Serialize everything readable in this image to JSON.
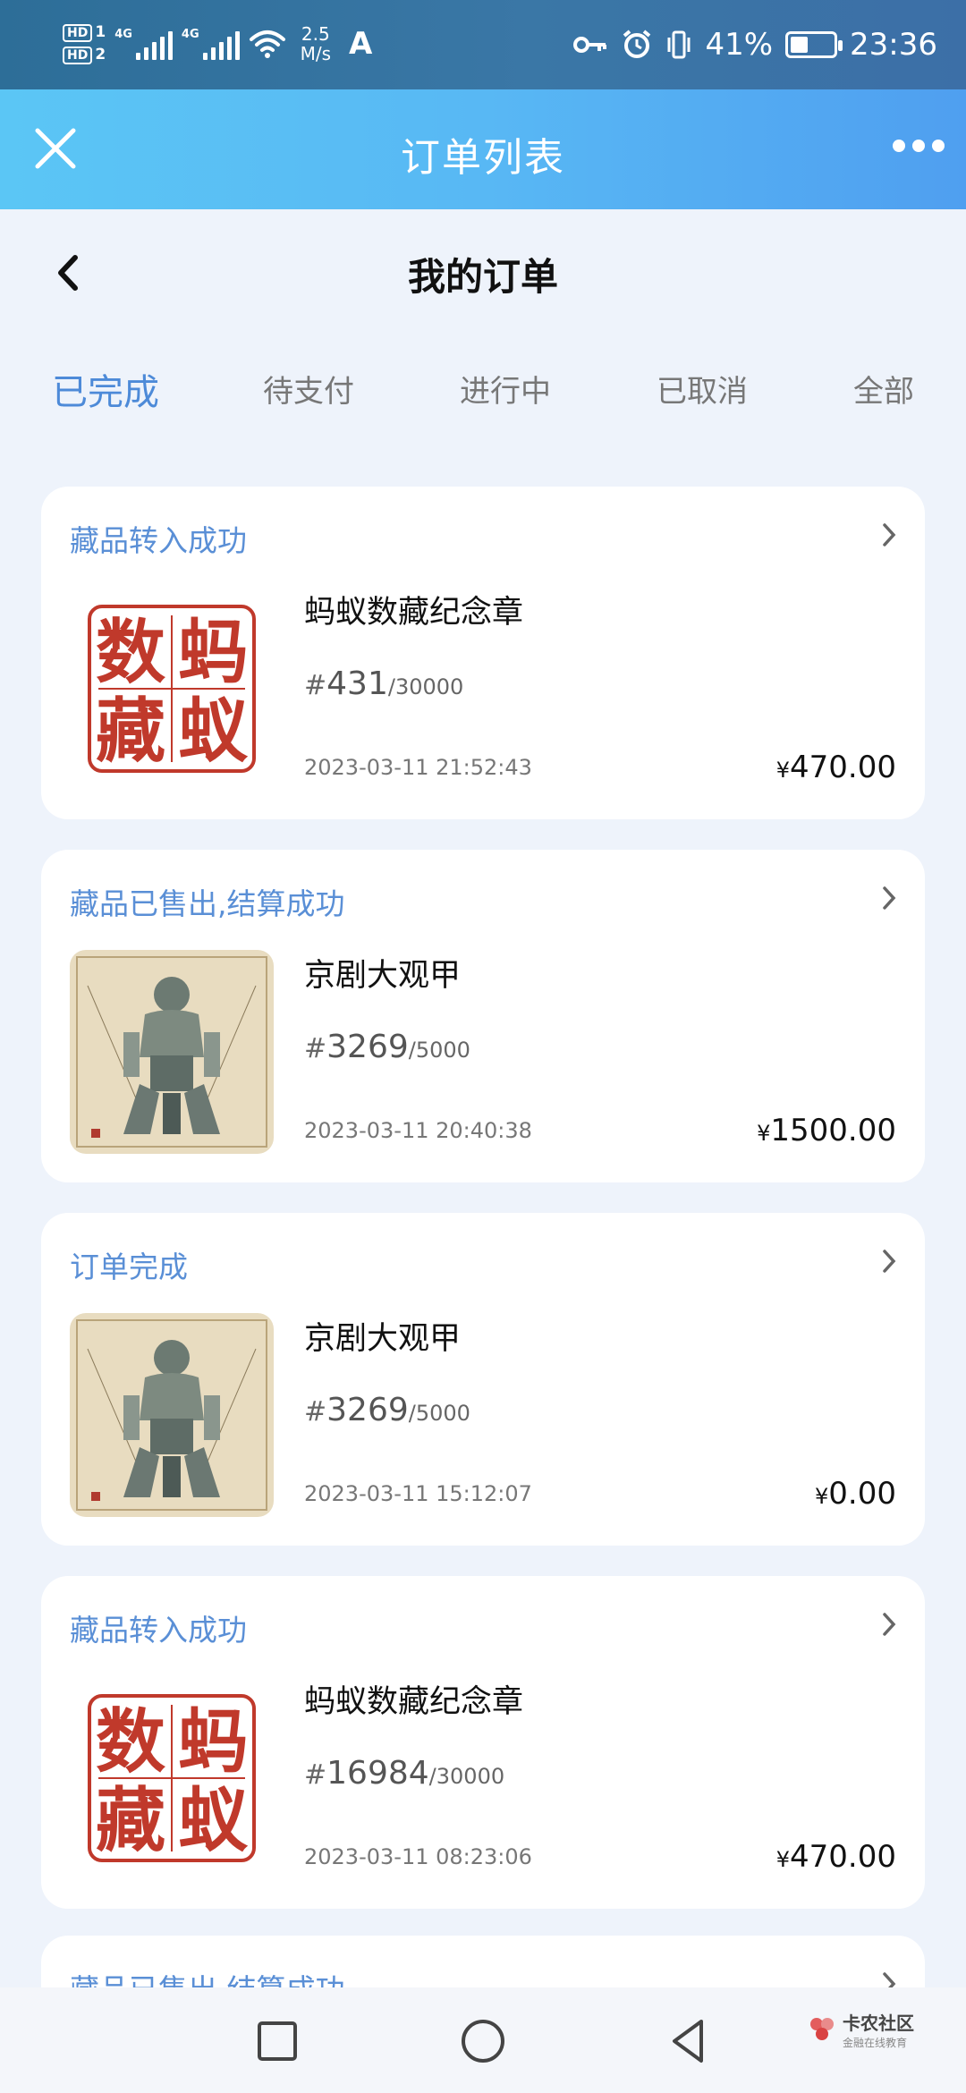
{
  "status_bar": {
    "hd1": "HD",
    "hd1_num": "1",
    "hd2": "HD",
    "hd2_num": "2",
    "net1": "4G",
    "net2": "4G",
    "speed_value": "2.5",
    "speed_unit": "M/s",
    "a_icon": "A",
    "battery_percent": "41%",
    "battery_level": 0.41,
    "time": "23:36"
  },
  "app_bar": {
    "title": "订单列表"
  },
  "page": {
    "title": "我的订单"
  },
  "tabs": [
    {
      "label": "已完成",
      "active": true
    },
    {
      "label": "待支付",
      "active": false
    },
    {
      "label": "进行中",
      "active": false
    },
    {
      "label": "已取消",
      "active": false
    },
    {
      "label": "全部",
      "active": false
    }
  ],
  "orders": [
    {
      "status": "藏品转入成功",
      "name": "蚂蚁数藏纪念章",
      "hash": "#",
      "number": "431",
      "total": "/30000",
      "date": "2023-03-11 21:52:43",
      "currency": "¥",
      "price": "470.00",
      "thumb_type": "ant-seal",
      "seal_chars": [
        "蚂",
        "数",
        "蚁",
        "藏"
      ]
    },
    {
      "status": "藏品已售出,结算成功",
      "name": "京剧大观甲",
      "hash": "#",
      "number": "3269",
      "total": "/5000",
      "date": "2023-03-11 20:40:38",
      "currency": "¥",
      "price": "1500.00",
      "thumb_type": "opera-armor"
    },
    {
      "status": "订单完成",
      "name": "京剧大观甲",
      "hash": "#",
      "number": "3269",
      "total": "/5000",
      "date": "2023-03-11 15:12:07",
      "currency": "¥",
      "price": "0.00",
      "thumb_type": "opera-armor"
    },
    {
      "status": "藏品转入成功",
      "name": "蚂蚁数藏纪念章",
      "hash": "#",
      "number": "16984",
      "total": "/30000",
      "date": "2023-03-11 08:23:06",
      "currency": "¥",
      "price": "470.00",
      "thumb_type": "ant-seal",
      "seal_chars": [
        "蚂",
        "数",
        "蚁",
        "藏"
      ]
    }
  ],
  "partial_order": {
    "status": "藏品已售出,结算成功"
  },
  "watermark": {
    "line1": "卡农社区",
    "line2": "金融在线教育"
  },
  "colors": {
    "accent": "#4d8ad8",
    "status_text": "#5a8fd6",
    "seal_red": "#c0392b"
  },
  "icons": {
    "close": "close-icon",
    "more": "more-dots-icon",
    "back": "back-arrow-icon",
    "chevron": "chevron-right-icon"
  }
}
